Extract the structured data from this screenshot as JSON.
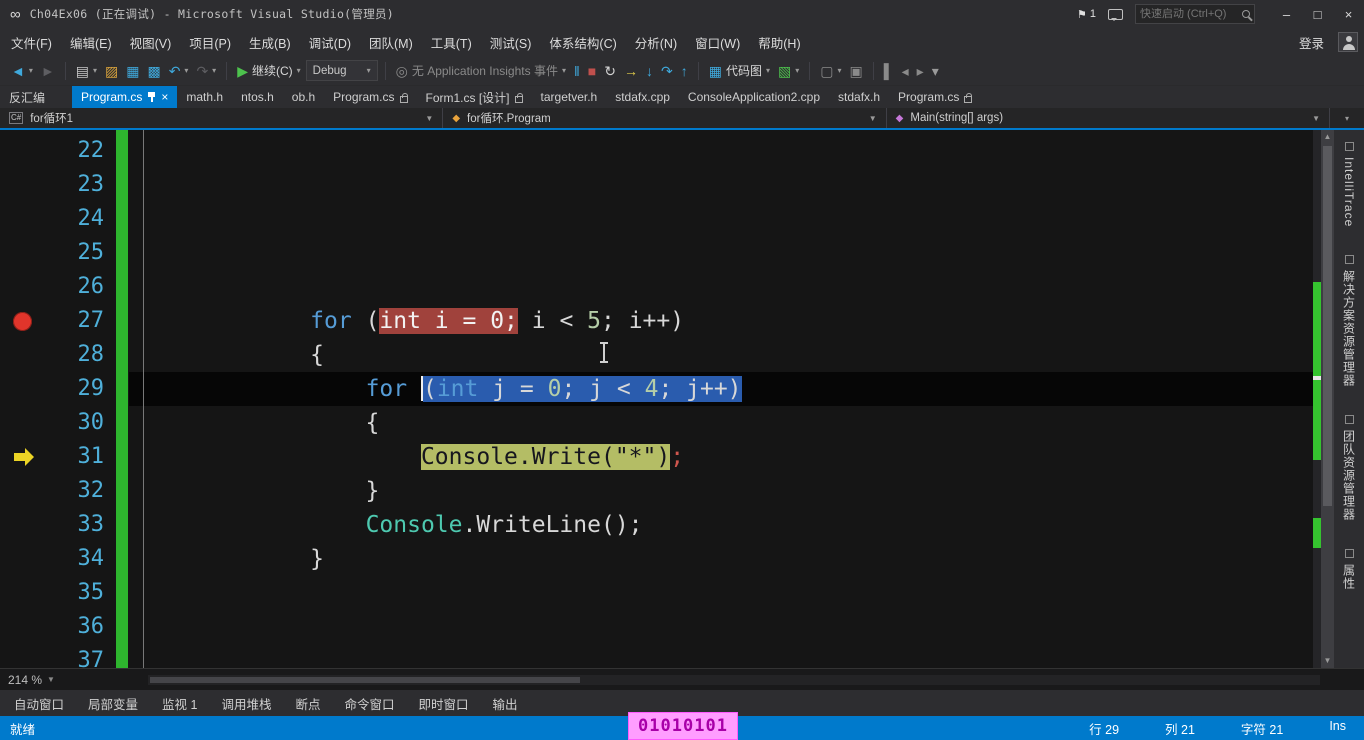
{
  "title_bar": {
    "app_title": "Ch04Ex06 (正在调试) - Microsoft Visual Studio(管理员)",
    "notification_count": "1",
    "quick_launch_placeholder": "快速启动 (Ctrl+Q)",
    "minimize_glyph": "–",
    "maximize_glyph": "□",
    "close_glyph": "×"
  },
  "menu_bar": {
    "items": [
      "文件(F)",
      "编辑(E)",
      "视图(V)",
      "项目(P)",
      "生成(B)",
      "调试(D)",
      "团队(M)",
      "工具(T)",
      "测试(S)",
      "体系结构(C)",
      "分析(N)",
      "窗口(W)",
      "帮助(H)"
    ],
    "sign_in": "登录"
  },
  "toolbar": {
    "items": [
      {
        "name": "navigate-back-button",
        "glyph": "◄",
        "color": "#3fa9dc",
        "dropdown": true
      },
      {
        "name": "navigate-forward-button",
        "glyph": "►",
        "color": "#5e5e62"
      },
      {
        "sep": true
      },
      {
        "name": "new-file-button",
        "glyph": "▤",
        "color": "#c8c8c8",
        "dropdown": true
      },
      {
        "name": "open-file-button",
        "glyph": "▨",
        "color": "#d9a33c"
      },
      {
        "name": "save-button",
        "glyph": "▦",
        "color": "#3fa9dc"
      },
      {
        "name": "save-all-button",
        "glyph": "▩",
        "color": "#3fa9dc"
      },
      {
        "name": "undo-button",
        "glyph": "↶",
        "color": "#3fa9dc",
        "dropdown": true
      },
      {
        "name": "redo-button",
        "glyph": "↷",
        "color": "#5e5e62",
        "dropdown": true
      },
      {
        "sep": true
      },
      {
        "name": "continue-button",
        "glyph": "▶",
        "color": "#4dc24d",
        "label": "继续(C)",
        "dropdown": true
      },
      {
        "name": "solution-configuration-combo",
        "combo": "Debug",
        "dropdown": true
      },
      {
        "sep": true
      },
      {
        "name": "application-insights-button",
        "glyph": "◎",
        "color": "#8a8a8a",
        "label": "无 Application Insights 事件",
        "muted": true,
        "dropdown": true
      },
      {
        "name": "pause-button",
        "glyph": "‖",
        "color": "#3fa9dc"
      },
      {
        "name": "stop-button",
        "glyph": "■",
        "color": "#c0504d"
      },
      {
        "name": "restart-button",
        "glyph": "↻",
        "color": "#d4d4d4"
      },
      {
        "name": "show-next-statement-button",
        "glyph": "→",
        "color": "#e3cd4a"
      },
      {
        "name": "step-into-button",
        "glyph": "↓",
        "color": "#3fa9dc"
      },
      {
        "name": "step-over-button",
        "glyph": "↷",
        "color": "#3fa9dc"
      },
      {
        "name": "step-out-button",
        "glyph": "↑",
        "color": "#3fa9dc"
      },
      {
        "sep": true
      },
      {
        "name": "code-map-button",
        "glyph": "▦",
        "color": "#3fa9dc",
        "label": "代码图",
        "dropdown": true
      },
      {
        "name": "code-lens-button",
        "glyph": "▧",
        "color": "#4dc24d",
        "dropdown": true
      },
      {
        "sep": true
      },
      {
        "name": "find-in-files-button",
        "glyph": "▢",
        "color": "#8a8a8a",
        "dropdown": true
      },
      {
        "name": "navigate-to-button",
        "glyph": "▣",
        "color": "#8a8a8a"
      },
      {
        "sep": true
      },
      {
        "name": "bookmark-button",
        "glyph": "▌",
        "color": "#8a8a8a"
      },
      {
        "name": "previous-bookmark-button",
        "glyph": "◂",
        "color": "#8a8a8a"
      },
      {
        "name": "next-bookmark-button",
        "glyph": "▸",
        "color": "#8a8a8a"
      },
      {
        "name": "toolbar-options-button",
        "glyph": "▾",
        "color": "#9a9a9a"
      }
    ]
  },
  "tab_bar": {
    "tabs": [
      {
        "label": "反汇编"
      },
      {
        "label": "Program.cs",
        "active": true,
        "pinned": true,
        "closable": true
      },
      {
        "label": "math.h"
      },
      {
        "label": "ntos.h"
      },
      {
        "label": "ob.h"
      },
      {
        "label": "Program.cs",
        "lock": true
      },
      {
        "label": "Form1.cs [设计]",
        "lock": true
      },
      {
        "label": "targetver.h"
      },
      {
        "label": "stdafx.cpp"
      },
      {
        "label": "ConsoleApplication2.cpp"
      },
      {
        "label": "stdafx.h"
      },
      {
        "label": "Program.cs",
        "lock": true
      }
    ]
  },
  "nav_bar": {
    "project": "for循环1",
    "type": "for循环.Program",
    "member": "Main(string[] args)"
  },
  "editor": {
    "zoom_label": "214 %",
    "lines": [
      {
        "n": "22",
        "segs": []
      },
      {
        "n": "23",
        "segs": []
      },
      {
        "n": "24",
        "segs": []
      },
      {
        "n": "25",
        "segs": []
      },
      {
        "n": "26",
        "segs": []
      },
      {
        "n": "27",
        "bp": true,
        "segs": [
          {
            "t": "            ",
            "c": "plain"
          },
          {
            "t": "for",
            "c": "kw"
          },
          {
            "t": " (",
            "c": "plain"
          },
          {
            "t": "int i = 0;",
            "c": "redhl"
          },
          {
            "t": " i < ",
            "c": "plain"
          },
          {
            "t": "5",
            "c": "num"
          },
          {
            "t": "; i++)",
            "c": "plain"
          }
        ]
      },
      {
        "n": "28",
        "segs": [
          {
            "t": "            {",
            "c": "plain"
          }
        ]
      },
      {
        "n": "29",
        "current": true,
        "segs": [
          {
            "t": "                ",
            "c": "plain"
          },
          {
            "t": "for",
            "c": "kw"
          },
          {
            "t": " ",
            "c": "plain"
          },
          {
            "t": "",
            "c": "caret"
          },
          {
            "t": "(",
            "c": "sel"
          },
          {
            "t": "int",
            "c": "sel kw"
          },
          {
            "t": " j = ",
            "c": "sel"
          },
          {
            "t": "0",
            "c": "sel num"
          },
          {
            "t": "; j < ",
            "c": "sel"
          },
          {
            "t": "4",
            "c": "sel num"
          },
          {
            "t": "; j++)",
            "c": "sel"
          }
        ]
      },
      {
        "n": "30",
        "segs": [
          {
            "t": "                {",
            "c": "plain"
          }
        ]
      },
      {
        "n": "31",
        "arrow": true,
        "segs": [
          {
            "t": "                    ",
            "c": "plain"
          },
          {
            "t": "Console.Write(\"*\")",
            "c": "curhl"
          },
          {
            "t": ";",
            "c": "semi"
          }
        ]
      },
      {
        "n": "32",
        "segs": [
          {
            "t": "                }",
            "c": "plain"
          }
        ]
      },
      {
        "n": "33",
        "segs": [
          {
            "t": "                ",
            "c": "plain"
          },
          {
            "t": "Console",
            "c": "type"
          },
          {
            "t": ".WriteLine();",
            "c": "plain"
          }
        ]
      },
      {
        "n": "34",
        "segs": [
          {
            "t": "            }",
            "c": "plain"
          }
        ]
      },
      {
        "n": "35",
        "segs": []
      },
      {
        "n": "36",
        "segs": []
      },
      {
        "n": "37",
        "segs": []
      }
    ]
  },
  "right_panel": {
    "tabs": [
      "IntelliTrace",
      "解决方案资源管理器",
      "团队资源管理器",
      "属性"
    ]
  },
  "bottom_panel": {
    "tabs": [
      "自动窗口",
      "局部变量",
      "监视 1",
      "调用堆栈",
      "断点",
      "命令窗口",
      "即时窗口",
      "输出"
    ]
  },
  "status_bar": {
    "state": "就绪",
    "line": "行 29",
    "column": "列 21",
    "character": "字符 21",
    "mode": "Ins"
  },
  "console_overlay": {
    "text": "01010101"
  }
}
